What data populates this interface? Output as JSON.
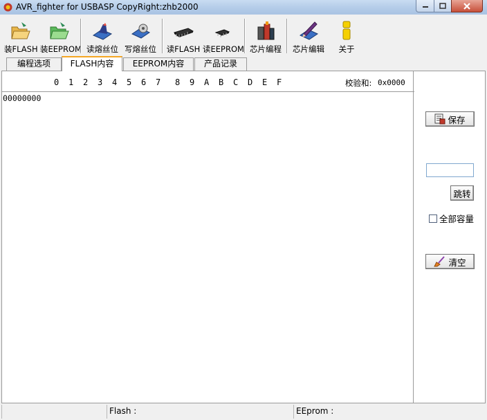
{
  "window": {
    "title": "AVR_fighter for USBASP CopyRight:zhb2000"
  },
  "toolbar": {
    "buttons": [
      {
        "label": "装FLASH",
        "icon": "folder-open-icon"
      },
      {
        "label": "装EEPROM",
        "icon": "folder-open-green-icon"
      },
      {
        "label": "读熔丝位",
        "icon": "read-fuse-icon"
      },
      {
        "label": "写熔丝位",
        "icon": "write-fuse-icon"
      },
      {
        "label": "读FLASH",
        "icon": "chip-icon"
      },
      {
        "label": "读EEPROM",
        "icon": "small-chip-icon"
      },
      {
        "label": "芯片编程",
        "icon": "program-chip-icon"
      },
      {
        "label": "芯片编辑",
        "icon": "edit-chip-icon"
      },
      {
        "label": "关于",
        "icon": "about-icon"
      }
    ]
  },
  "tabs": [
    {
      "label": "编程选项",
      "active": false
    },
    {
      "label": "FLASH内容",
      "active": true
    },
    {
      "label": "EEPROM内容",
      "active": false
    },
    {
      "label": "产品记录",
      "active": false
    }
  ],
  "hex": {
    "columns": [
      "0",
      "1",
      "2",
      "3",
      "4",
      "5",
      "6",
      "7",
      "8",
      "9",
      "A",
      "B",
      "C",
      "D",
      "E",
      "F"
    ],
    "checksum_label": "校验和:",
    "checksum_value": "0x0000",
    "first_address": "00000000"
  },
  "side": {
    "save_label": "保存",
    "jump_value": "",
    "jump_label": "跳转",
    "full_capacity_label": "全部容量",
    "full_capacity_checked": false,
    "clear_label": "清空"
  },
  "status": {
    "cell1": "",
    "flash_label": "Flash :",
    "eeprom_label": "EEprom :"
  }
}
